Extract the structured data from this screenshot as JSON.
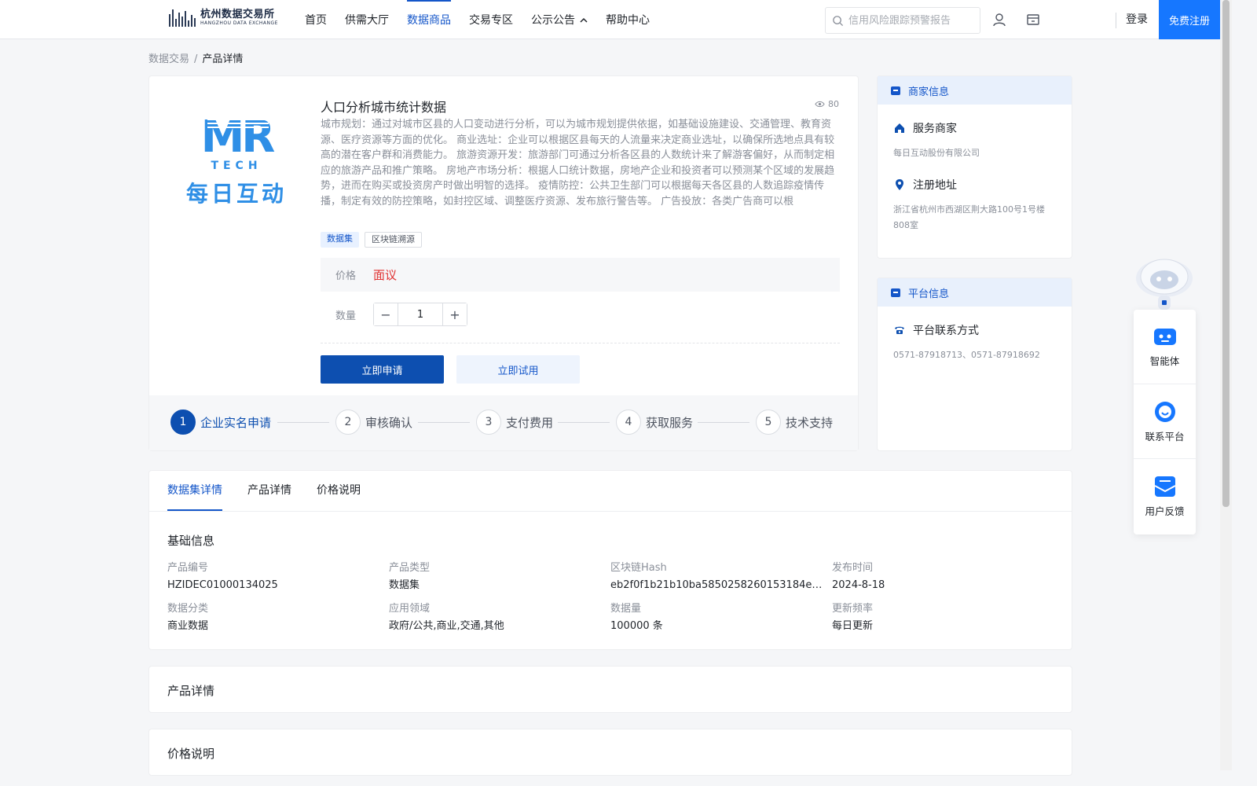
{
  "header": {
    "logo_cn": "杭州数据交易所",
    "logo_en": "HANGZHOU DATA EXCHANGE",
    "nav": [
      {
        "label": "首页"
      },
      {
        "label": "供需大厅"
      },
      {
        "label": "数据商品",
        "active": true
      },
      {
        "label": "交易专区"
      },
      {
        "label": "公示公告",
        "has_dropdown": true
      },
      {
        "label": "帮助中心"
      }
    ],
    "search_placeholder": "信用风险跟踪预警报告",
    "login_label": "登录",
    "register_label": "免费注册",
    "accent_color": "#1677ff"
  },
  "breadcrumb": {
    "root": "数据交易",
    "sep": "/",
    "current": "产品详情"
  },
  "product": {
    "logo_letters": "MR",
    "logo_tech": "TECH",
    "logo_cn": "每日互动",
    "title": "人口分析城市统计数据",
    "views": "80",
    "description": "城市规划：通过对城市区县的人口变动进行分析，可以为城市规划提供依据，如基础设施建设、交通管理、教育资源、医疗资源等方面的优化。 商业选址：企业可以根据区县每天的人流量来决定商业选址，以确保所选地点具有较高的潜在客户群和消费能力。 旅游资源开发：旅游部门可通过分析各区县的人数统计来了解游客偏好，从而制定相应的旅游产品和推广策略。 房地产市场分析：根据人口统计数据，房地产企业和投资者可以预测某个区域的发展趋势，进而在购买或投资房产时做出明智的选择。 疫情防控：公共卫生部门可以根据每天各区县的人数追踪疫情传播，制定有效的防控策略，如封控区域、调整医疗资源、发布旅行警告等。 广告投放：各类广告商可以根",
    "tags": [
      "数据集",
      "区块链溯源"
    ],
    "price_label": "价格",
    "price_value": "面议",
    "price_color": "#e03131",
    "qty_label": "数量",
    "qty_value": "1",
    "apply_label": "立即申请",
    "try_label": "立即试用"
  },
  "steps": [
    {
      "num": "1",
      "label": "企业实名申请",
      "active": true
    },
    {
      "num": "2",
      "label": "审核确认"
    },
    {
      "num": "3",
      "label": "支付费用"
    },
    {
      "num": "4",
      "label": "获取服务"
    },
    {
      "num": "5",
      "label": "技术支持"
    }
  ],
  "merchant": {
    "head": "商家信息",
    "service_label": "服务商家",
    "service_value": "每日互动股份有限公司",
    "address_label": "注册地址",
    "address_value": "浙江省杭州市西湖区荆大路100号1号楼808室"
  },
  "platform": {
    "head": "平台信息",
    "contact_label": "平台联系方式",
    "contact_value": "0571-87918713、0571-87918692"
  },
  "floating": [
    {
      "label": "智能体",
      "icon": "robot-icon"
    },
    {
      "label": "联系平台",
      "icon": "headset-icon"
    },
    {
      "label": "用户反馈",
      "icon": "feedback-icon"
    }
  ],
  "detail_tabs": [
    "数据集详情",
    "产品详情",
    "价格说明"
  ],
  "basic_info": {
    "title": "基础信息",
    "items": [
      {
        "label": "产品编号",
        "value": "HZIDEC01000134025"
      },
      {
        "label": "产品类型",
        "value": "数据集"
      },
      {
        "label": "区块链Hash",
        "value": "eb2f0f1b21b10ba5850258260153184e16f..."
      },
      {
        "label": "发布时间",
        "value": "2024-8-18"
      },
      {
        "label": "数据分类",
        "value": "商业数据"
      },
      {
        "label": "应用领域",
        "value": "政府/公共,商业,交通,其他"
      },
      {
        "label": "数据量",
        "value": "100000 条"
      },
      {
        "label": "更新频率",
        "value": "每日更新"
      }
    ]
  },
  "sections": {
    "product_detail": "产品详情",
    "price_desc": "价格说明"
  }
}
